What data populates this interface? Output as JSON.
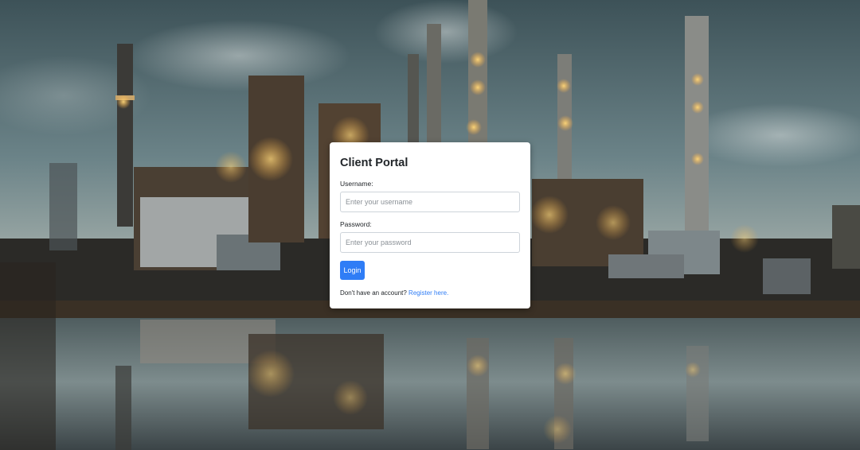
{
  "login": {
    "title": "Client Portal",
    "username_label": "Username:",
    "username_placeholder": "Enter your username",
    "username_value": "",
    "password_label": "Password:",
    "password_placeholder": "Enter your password",
    "password_value": "",
    "submit_label": "Login",
    "register_prompt": "Don't have an account?",
    "register_link": "Register here."
  },
  "colors": {
    "accent": "#2f7df6",
    "card_background": "#ffffff",
    "title_text": "#212529"
  },
  "background": {
    "icon": "industrial-refinery-photo"
  }
}
